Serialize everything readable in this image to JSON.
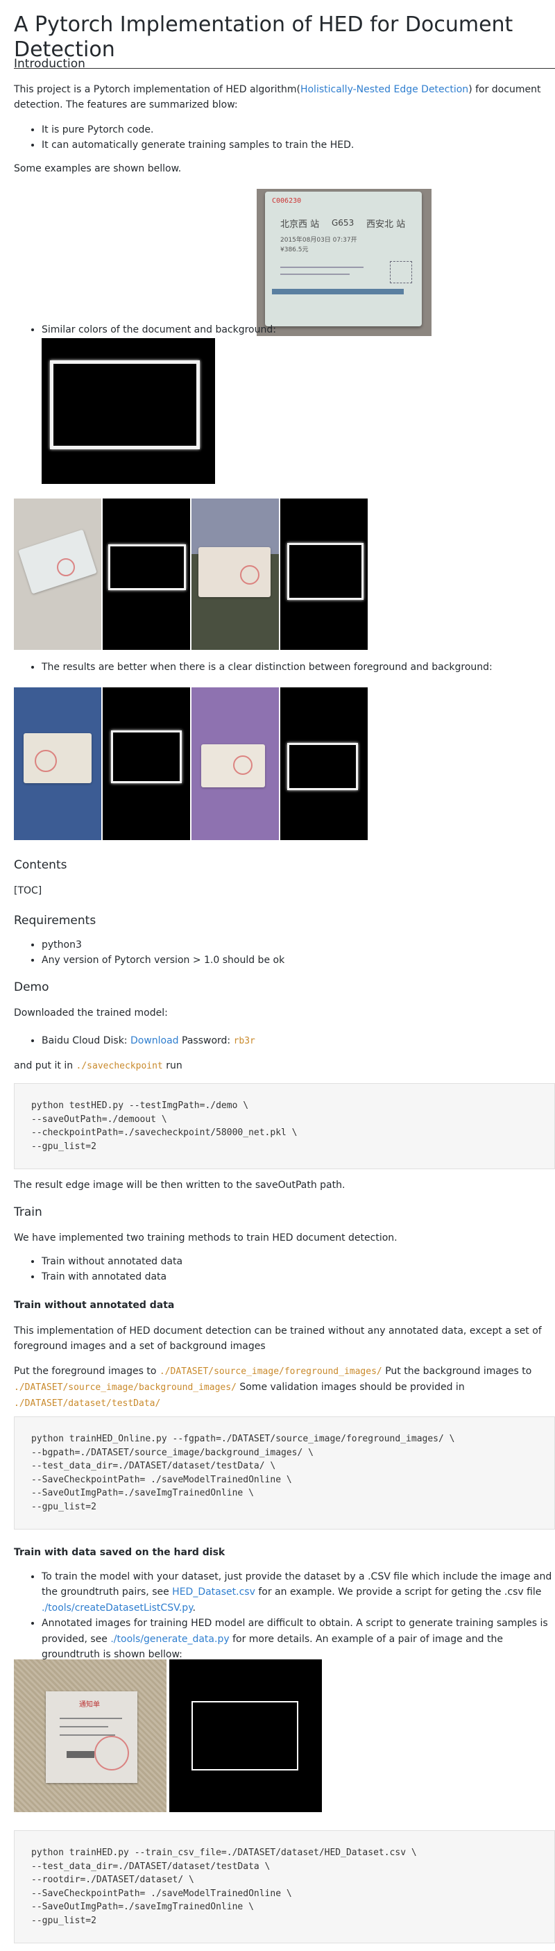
{
  "title": "A Pytorch Implementation of HED for Document Detection",
  "intro": {
    "heading": "Introduction",
    "p1_before": "This project is a Pytorch implementation of HED algorithm(",
    "p1_link": "Holistically-Nested Edge Detection",
    "p1_after": ") for document detection. The features are summarized blow:",
    "bullets": [
      "It is pure Pytorch code.",
      "It can automatically generate training samples to train the HED."
    ],
    "examples_text": "Some examples are shown bellow.",
    "similar_colors": "Similar colors of the document and background:",
    "clear_distinction": "The results are better when there is a clear distinction between foreground and background:"
  },
  "contents": {
    "heading": "Contents",
    "toc": "[TOC]"
  },
  "requirements": {
    "heading": "Requirements",
    "items": [
      "python3",
      "Any version of Pytorch version > 1.0 should be ok"
    ]
  },
  "demo": {
    "heading": "Demo",
    "downloaded": "Downloaded the trained model:",
    "baidu_prefix": "Baidu Cloud Disk: ",
    "download_link": "Download",
    "password_label": " Password: ",
    "password": "rb3r",
    "put_prefix": "and put it in ",
    "put_path": "./savecheckpoint",
    "put_suffix": " run",
    "code": "python testHED.py --testImgPath=./demo \\\n--saveOutPath=./demoout \\\n--checkpointPath=./savecheckpoint/58000_net.pkl \\\n--gpu_list=2",
    "result_text": "The result edge image will be then written to the saveOutPath path."
  },
  "train": {
    "heading": "Train",
    "intro": "We have implemented two training methods to train HED document detection.",
    "methods": [
      "Train without annotated data",
      "Train with annotated data"
    ],
    "without": {
      "heading": "Train without annotated data",
      "p1": "This implementation of HED document detection can be trained without any annotated data, except a set of foreground images and a set of background images",
      "p2_a": "Put the foreground images to ",
      "p2_path1": "./DATASET/source_image/foreground_images/",
      "p2_b": " Put the background images to ",
      "p2_path2": "./DATASET/source_image/background_images/",
      "p2_c": " Some validation images should be provided in ",
      "p2_path3": "./DATASET/dataset/testData/",
      "code": "python trainHED_Online.py --fgpath=./DATASET/source_image/foreground_images/ \\\n--bgpath=./DATASET/source_image/background_images/ \\\n--test_data_dir=./DATASET/dataset/testData/ \\\n--SaveCheckpointPath= ./saveModelTrainedOnline \\\n--SaveOutImgPath=./saveImgTrainedOnline \\\n--gpu_list=2"
    },
    "with_disk": {
      "heading": "Train with data saved on the hard disk",
      "b1_a": "To train the model with your dataset, just provide the dataset by a .CSV file which include the image and the groundtruth pairs, see ",
      "b1_link1": "HED_Dataset.csv",
      "b1_b": " for an example. We provide a script for geting the .csv file ",
      "b1_link2": "./tools/createDatasetListCSV.py",
      "b1_c": ".",
      "b2_a": "Annotated images for training HED model are difficult to obtain. A script to generate training samples is provided, see ",
      "b2_link": "./tools/generate_data.py",
      "b2_b": " for more details. An example of a pair of image and the groundtruth is shown bellow:",
      "code": "python trainHED.py --train_csv_file=./DATASET/dataset/HED_Dataset.csv \\\n--test_data_dir=./DATASET/dataset/testData \\\n--rootdir=./DATASET/dataset/ \\\n--SaveCheckpointPath= ./saveModelTrainedOnline \\\n--SaveOutImgPath=./saveImgTrainedOnline \\\n--gpu_list=2"
    }
  },
  "images": {
    "ticket_code": "C006230",
    "ticket_from": "北京西 站",
    "ticket_train": "G653",
    "ticket_to": "西安北 站",
    "ticket_date": "2015年08月03日 07:37开",
    "ticket_price": "¥386.5元",
    "label_card": "通知单"
  },
  "colors": {
    "link": "#2f7ecf",
    "inline_code": "#c98a2c",
    "code_bg": "#f6f6f6"
  }
}
